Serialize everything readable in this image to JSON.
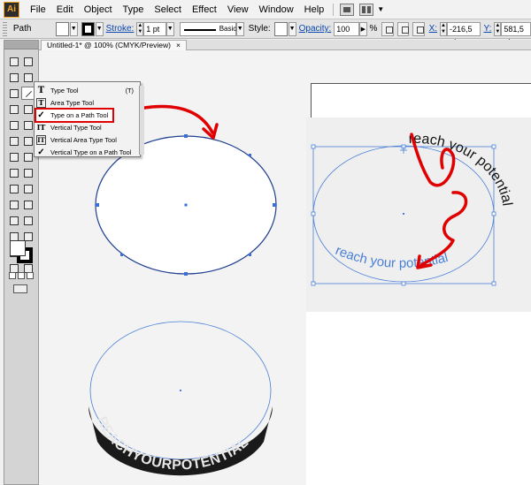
{
  "app": {
    "logo_text": "Ai"
  },
  "menu": [
    "File",
    "Edit",
    "Object",
    "Type",
    "Select",
    "Effect",
    "View",
    "Window",
    "Help"
  ],
  "control_bar": {
    "object_type": "Path",
    "stroke_label": "Stroke:",
    "stroke_weight": "1 pt",
    "brush_label": "Basic",
    "style_label": "Style:",
    "opacity_label": "Opacity:",
    "opacity_value": "100",
    "opacity_unit": "%",
    "x_label": "X:",
    "x_value": "-216,5 pt",
    "y_label": "Y:",
    "y_value": "581,5 pt"
  },
  "document": {
    "tab_title": "Untitled-1* @ 100% (CMYK/Preview)",
    "close_glyph": "×"
  },
  "flyout": {
    "items": [
      {
        "label": "Type Tool",
        "icon": "type-icon",
        "glyph": "T",
        "shortcut": "(T)"
      },
      {
        "label": "Area Type Tool",
        "icon": "area-type-icon",
        "glyph": "T"
      },
      {
        "label": "Type on a Path Tool",
        "icon": "type-on-path-icon",
        "glyph": "✓"
      },
      {
        "label": "Vertical Type Tool",
        "icon": "vertical-type-icon",
        "glyph": "IT"
      },
      {
        "label": "Vertical Area Type Tool",
        "icon": "vertical-area-type-icon",
        "glyph": "IT"
      },
      {
        "label": "Vertical Type on a Path Tool",
        "icon": "vertical-type-on-path-icon",
        "glyph": "✓"
      }
    ],
    "active_index": 2
  },
  "canvas": {
    "ref_text_black": "reach your potential",
    "ref_text_blue": "reach your potential",
    "badge_text": "REACHYOURPOTENTIAL"
  },
  "colors": {
    "annotation_red": "#e00000",
    "selection_blue": "#4a7fd6",
    "path_stroke": "#1f3f8f",
    "badge_fill": "#1a1a1a"
  }
}
